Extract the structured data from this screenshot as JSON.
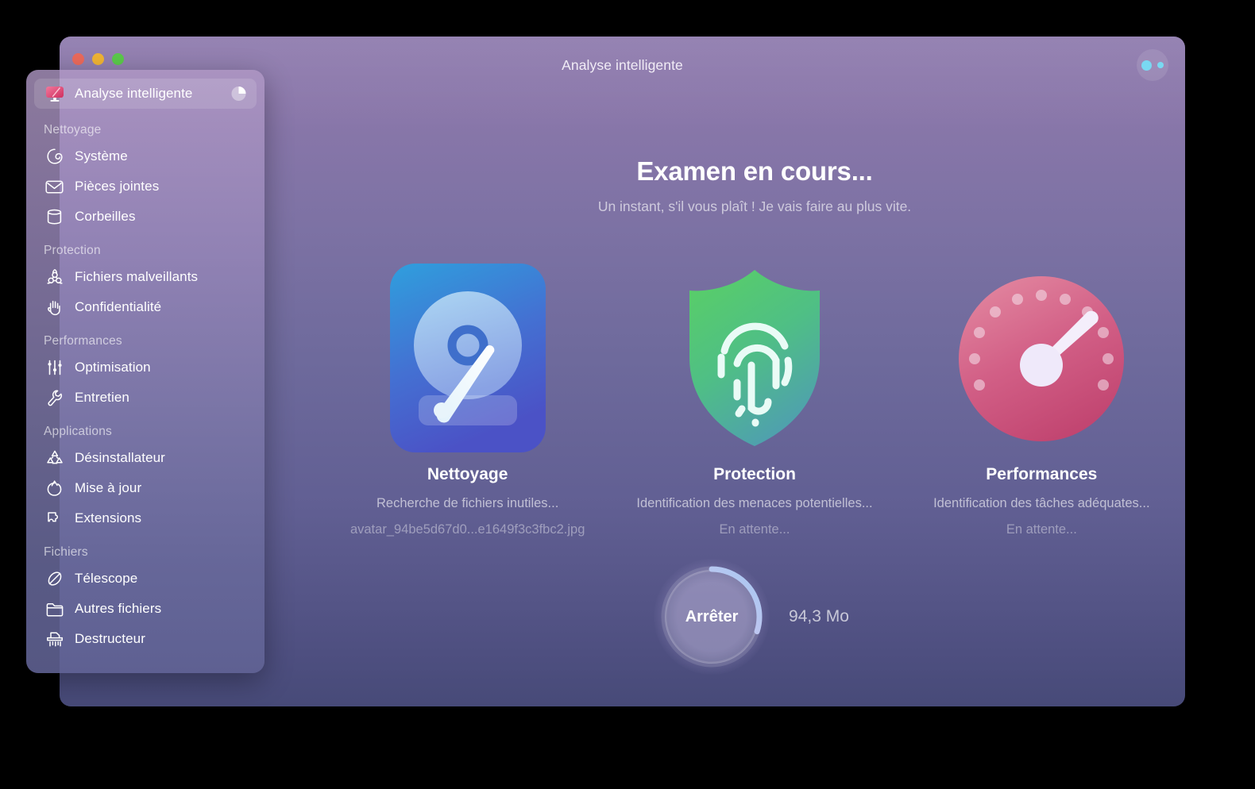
{
  "window": {
    "title": "Analyse intelligente",
    "traffic_lights": [
      "close-button",
      "minimize-button",
      "zoom-button"
    ],
    "menu_button_icon": "two-dots-icon"
  },
  "sidebar": {
    "selected_item": {
      "label": "Analyse intelligente",
      "icon": "smart-scan-monitor-icon",
      "badge_icon": "pie-progress-icon"
    },
    "groups": [
      {
        "title": "Nettoyage",
        "items": [
          {
            "label": "Système",
            "icon": "system-junk-icon"
          },
          {
            "label": "Pièces jointes",
            "icon": "mail-attachments-icon"
          },
          {
            "label": "Corbeilles",
            "icon": "trash-bins-icon"
          }
        ]
      },
      {
        "title": "Protection",
        "items": [
          {
            "label": "Fichiers malveillants",
            "icon": "biohazard-malware-icon"
          },
          {
            "label": "Confidentialité",
            "icon": "privacy-hand-icon"
          }
        ]
      },
      {
        "title": "Performances",
        "items": [
          {
            "label": "Optimisation",
            "icon": "sliders-optimization-icon"
          },
          {
            "label": "Entretien",
            "icon": "wrench-maintenance-icon"
          }
        ]
      },
      {
        "title": "Applications",
        "items": [
          {
            "label": "Désinstallateur",
            "icon": "uninstaller-icon"
          },
          {
            "label": "Mise à jour",
            "icon": "updater-refresh-icon"
          },
          {
            "label": "Extensions",
            "icon": "puzzle-extensions-icon"
          }
        ]
      },
      {
        "title": "Fichiers",
        "items": [
          {
            "label": "Télescope",
            "icon": "space-lens-telescope-icon"
          },
          {
            "label": "Autres fichiers",
            "icon": "folder-other-files-icon"
          },
          {
            "label": "Destructeur",
            "icon": "shredder-icon"
          }
        ]
      }
    ]
  },
  "main": {
    "headline": "Examen en cours...",
    "subhead": "Un instant, s'il vous plaît ! Je vais faire au plus vite.",
    "cards": [
      {
        "title": "Nettoyage",
        "icon": "hard-drive-icon",
        "status": "Recherche de fichiers inutiles...",
        "detail": "avatar_94be5d67d0...e1649f3c3fbc2.jpg",
        "accent": "#4a7fd4"
      },
      {
        "title": "Protection",
        "icon": "shield-fingerprint-icon",
        "status": "Identification des menaces potentielles...",
        "detail": "En attente...",
        "accent": "#4fbb74"
      },
      {
        "title": "Performances",
        "icon": "speedometer-gauge-icon",
        "status": "Identification des tâches adéquates...",
        "detail": "En attente...",
        "accent": "#d4577f"
      }
    ]
  },
  "footer": {
    "stop_label": "Arrêter",
    "size_label": "94,3 Mo",
    "progress_percent": 30
  },
  "colors": {
    "bg_top": "#8e7aad",
    "bg_bottom": "#474a78",
    "progress_start": "#e3bfe8",
    "progress_end": "#a8c8f0",
    "accent_cyan": "#79d9f2"
  }
}
